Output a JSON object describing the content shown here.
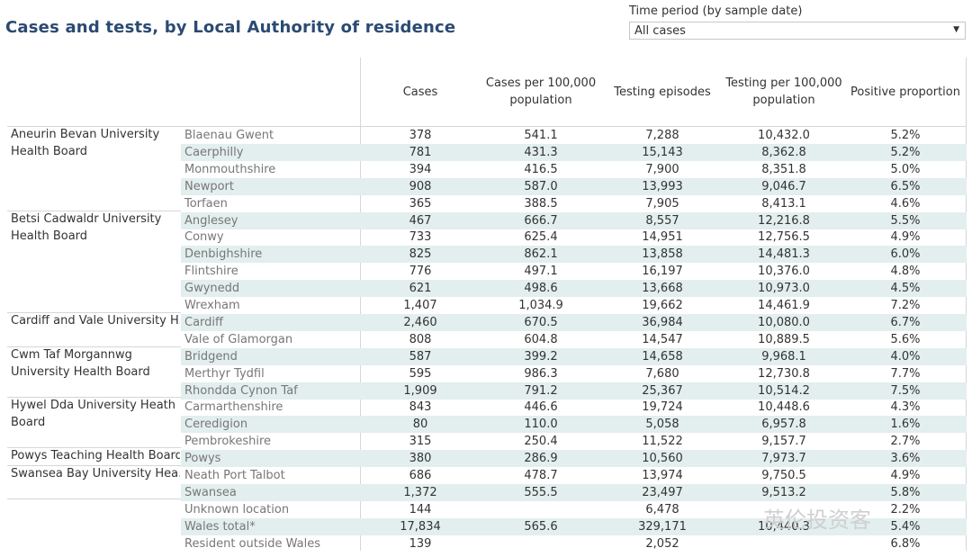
{
  "title": "Cases and tests, by Local Authority of residence",
  "filter": {
    "label": "Time period (by sample date)",
    "value": "All cases"
  },
  "headers": {
    "cases": "Cases",
    "cases_per_100k": "Cases per 100,000 population",
    "testing_episodes": "Testing episodes",
    "testing_per_100k": "Testing per 100,000 population",
    "positive_proportion": "Positive proportion"
  },
  "health_boards": [
    "Aneurin Bevan University Health Board",
    "Betsi Cadwaldr University Health Board",
    "Cardiff and Vale University H..",
    "Cwm Taf Morgannwg University Health Board",
    "Hywel Dda University Heath Board",
    "Powys Teaching Health Board",
    "Swansea Bay University Hea.."
  ],
  "rows": [
    {
      "la": "Blaenau Gwent",
      "cases": "378",
      "cases_per_100k": "541.1",
      "tests": "7,288",
      "tests_per_100k": "10,432.0",
      "positive": "5.2%"
    },
    {
      "la": "Caerphilly",
      "cases": "781",
      "cases_per_100k": "431.3",
      "tests": "15,143",
      "tests_per_100k": "8,362.8",
      "positive": "5.2%"
    },
    {
      "la": "Monmouthshire",
      "cases": "394",
      "cases_per_100k": "416.5",
      "tests": "7,900",
      "tests_per_100k": "8,351.8",
      "positive": "5.0%"
    },
    {
      "la": "Newport",
      "cases": "908",
      "cases_per_100k": "587.0",
      "tests": "13,993",
      "tests_per_100k": "9,046.7",
      "positive": "6.5%"
    },
    {
      "la": "Torfaen",
      "cases": "365",
      "cases_per_100k": "388.5",
      "tests": "7,905",
      "tests_per_100k": "8,413.1",
      "positive": "4.6%"
    },
    {
      "la": "Anglesey",
      "cases": "467",
      "cases_per_100k": "666.7",
      "tests": "8,557",
      "tests_per_100k": "12,216.8",
      "positive": "5.5%"
    },
    {
      "la": "Conwy",
      "cases": "733",
      "cases_per_100k": "625.4",
      "tests": "14,951",
      "tests_per_100k": "12,756.5",
      "positive": "4.9%"
    },
    {
      "la": "Denbighshire",
      "cases": "825",
      "cases_per_100k": "862.1",
      "tests": "13,858",
      "tests_per_100k": "14,481.3",
      "positive": "6.0%"
    },
    {
      "la": "Flintshire",
      "cases": "776",
      "cases_per_100k": "497.1",
      "tests": "16,197",
      "tests_per_100k": "10,376.0",
      "positive": "4.8%"
    },
    {
      "la": "Gwynedd",
      "cases": "621",
      "cases_per_100k": "498.6",
      "tests": "13,668",
      "tests_per_100k": "10,973.0",
      "positive": "4.5%"
    },
    {
      "la": "Wrexham",
      "cases": "1,407",
      "cases_per_100k": "1,034.9",
      "tests": "19,662",
      "tests_per_100k": "14,461.9",
      "positive": "7.2%"
    },
    {
      "la": "Cardiff",
      "cases": "2,460",
      "cases_per_100k": "670.5",
      "tests": "36,984",
      "tests_per_100k": "10,080.0",
      "positive": "6.7%"
    },
    {
      "la": "Vale of Glamorgan",
      "cases": "808",
      "cases_per_100k": "604.8",
      "tests": "14,547",
      "tests_per_100k": "10,889.5",
      "positive": "5.6%"
    },
    {
      "la": "Bridgend",
      "cases": "587",
      "cases_per_100k": "399.2",
      "tests": "14,658",
      "tests_per_100k": "9,968.1",
      "positive": "4.0%"
    },
    {
      "la": "Merthyr Tydfil",
      "cases": "595",
      "cases_per_100k": "986.3",
      "tests": "7,680",
      "tests_per_100k": "12,730.8",
      "positive": "7.7%"
    },
    {
      "la": "Rhondda Cynon Taf",
      "cases": "1,909",
      "cases_per_100k": "791.2",
      "tests": "25,367",
      "tests_per_100k": "10,514.2",
      "positive": "7.5%"
    },
    {
      "la": "Carmarthenshire",
      "cases": "843",
      "cases_per_100k": "446.6",
      "tests": "19,724",
      "tests_per_100k": "10,448.6",
      "positive": "4.3%"
    },
    {
      "la": "Ceredigion",
      "cases": "80",
      "cases_per_100k": "110.0",
      "tests": "5,058",
      "tests_per_100k": "6,957.8",
      "positive": "1.6%"
    },
    {
      "la": "Pembrokeshire",
      "cases": "315",
      "cases_per_100k": "250.4",
      "tests": "11,522",
      "tests_per_100k": "9,157.7",
      "positive": "2.7%"
    },
    {
      "la": "Powys",
      "cases": "380",
      "cases_per_100k": "286.9",
      "tests": "10,560",
      "tests_per_100k": "7,973.7",
      "positive": "3.6%"
    },
    {
      "la": "Neath Port Talbot",
      "cases": "686",
      "cases_per_100k": "478.7",
      "tests": "13,974",
      "tests_per_100k": "9,750.5",
      "positive": "4.9%"
    },
    {
      "la": "Swansea",
      "cases": "1,372",
      "cases_per_100k": "555.5",
      "tests": "23,497",
      "tests_per_100k": "9,513.2",
      "positive": "5.8%"
    },
    {
      "la": "Unknown location",
      "cases": "144",
      "cases_per_100k": "",
      "tests": "6,478",
      "tests_per_100k": "",
      "positive": "2.2%"
    },
    {
      "la": "Wales total*",
      "cases": "17,834",
      "cases_per_100k": "565.6",
      "tests": "329,171",
      "tests_per_100k": "10,440.3",
      "positive": "5.4%"
    },
    {
      "la": "Resident outside Wales",
      "cases": "139",
      "cases_per_100k": "",
      "tests": "2,052",
      "tests_per_100k": "",
      "positive": "6.8%"
    }
  ],
  "watermark": "英伦投资客"
}
